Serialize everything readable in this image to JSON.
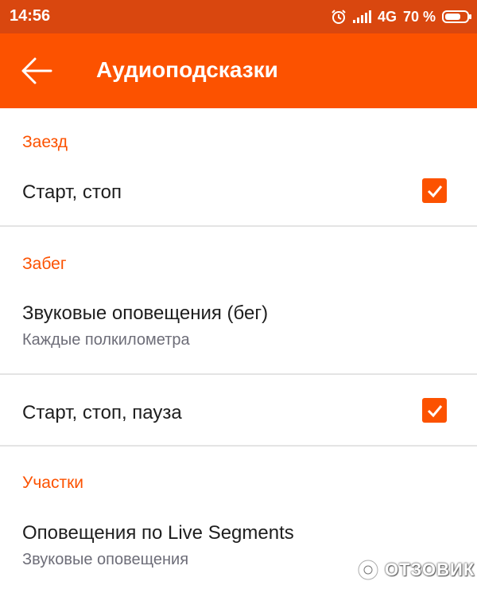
{
  "status_bar": {
    "time": "14:56",
    "network": "4G",
    "battery": "70 %",
    "icons": [
      "alarm-icon",
      "signal-icon",
      "battery-icon"
    ]
  },
  "app_bar": {
    "title": "Аудиоподсказки",
    "back_icon": "arrow-left-icon",
    "color": "#fc5200"
  },
  "sections": {
    "ride": {
      "header": "Заезд",
      "start_stop": {
        "title": "Старт, стоп",
        "checked": true
      }
    },
    "run": {
      "header": "Забег",
      "audio_alerts": {
        "title": "Звуковые оповещения (бег)",
        "subtitle": "Каждые полкилометра"
      },
      "start_stop_pause": {
        "title": "Старт, стоп, пауза",
        "checked": true
      }
    },
    "segments": {
      "header": "Участки",
      "live_segments": {
        "title": "Оповещения по Live Segments",
        "subtitle": "Звуковые оповещения"
      }
    }
  },
  "watermark": {
    "text": "ОТЗОВИК"
  },
  "colors": {
    "accent": "#fc5200",
    "status_bar": "#d9470f",
    "text": "#1e1e1e",
    "secondary_text": "#6d6d78",
    "divider": "#e4e4e4"
  }
}
